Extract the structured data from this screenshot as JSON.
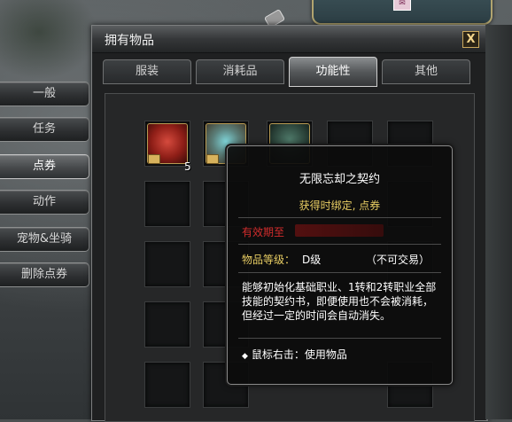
{
  "window": {
    "title": "拥有物品",
    "close_label": "X"
  },
  "categories": [
    {
      "label": "一般",
      "active": false
    },
    {
      "label": "任务",
      "active": false
    },
    {
      "label": "点券",
      "active": true
    },
    {
      "label": "动作",
      "active": false
    },
    {
      "label": "宠物&坐骑",
      "active": false
    },
    {
      "label": "删除点券",
      "active": false
    }
  ],
  "tabs": [
    {
      "label": "服装",
      "active": false
    },
    {
      "label": "消耗品",
      "active": false
    },
    {
      "label": "功能性",
      "active": true
    },
    {
      "label": "其他",
      "active": false
    }
  ],
  "slots": {
    "slot_0": {
      "icon": "red-seal-item-icon",
      "count": "5"
    },
    "slot_1": {
      "icon": "gem-box-item-icon",
      "count": ""
    },
    "slot_2": {
      "icon": "hook-item-icon",
      "count": ""
    }
  },
  "tooltip": {
    "name": "无限忘却之契约",
    "bind": "获得时绑定, 点券",
    "expiry_label": "有效期至",
    "grade_label": "物品等级：",
    "grade_value": "D级",
    "trade": "（不可交易）",
    "description": "能够初始化基础职业、1转和2转职业全部技能的契约书，即便使用也不会被消耗，但经过一定的时间会自动消失。",
    "action": "鼠标右击：使用物品"
  },
  "colors": {
    "accent_gold": "#e8cd63",
    "expiry_red": "#d12c2c",
    "frame_gold": "#b89a52"
  }
}
